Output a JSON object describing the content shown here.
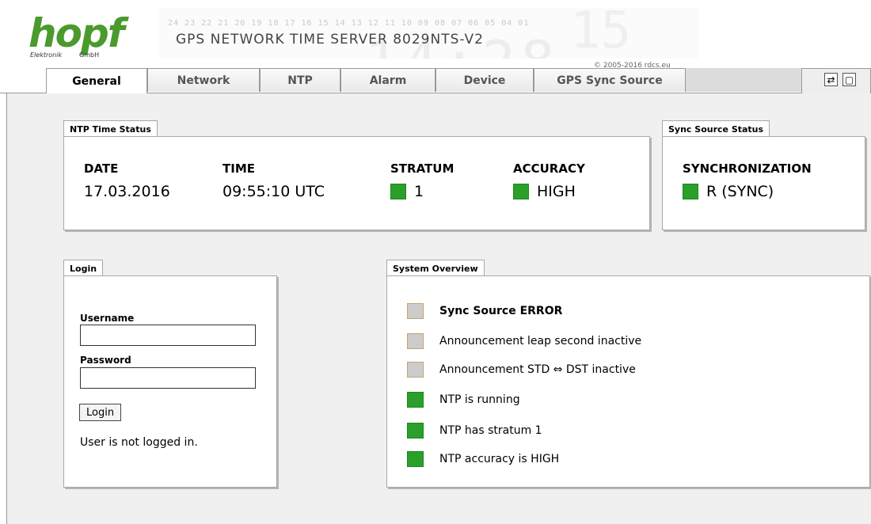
{
  "header": {
    "logo": {
      "word": "hopf",
      "sub_left": "Elektronik",
      "sub_right": "GmbH"
    },
    "banner_numbers": "24 23 22 21 20 19 18 17 16 15 14 13 12 11 10 09 08 07 06 05 04 01",
    "product_title": "GPS NETWORK TIME SERVER 8029NTS-V2",
    "copyright_prefix": "© 2005-2016 ",
    "copyright_link": "rdcs.eu"
  },
  "tabs": [
    {
      "label": "General",
      "active": true
    },
    {
      "label": "Network",
      "active": false
    },
    {
      "label": "NTP",
      "active": false
    },
    {
      "label": "Alarm",
      "active": false
    },
    {
      "label": "Device",
      "active": false
    },
    {
      "label": "GPS Sync Source",
      "active": false
    }
  ],
  "corner_buttons": {
    "refresh_glyph": "⇄",
    "window_glyph": "▢"
  },
  "ntp_status": {
    "title": "NTP Time Status",
    "date_label": "DATE",
    "date_value": "17.03.2016",
    "time_label": "TIME",
    "time_value": "09:55:10 UTC",
    "stratum_label": "STRATUM",
    "stratum_value": "1",
    "stratum_color": "#2aa02a",
    "accuracy_label": "ACCURACY",
    "accuracy_value": "HIGH",
    "accuracy_color": "#2aa02a"
  },
  "sync_status": {
    "title": "Sync Source Status",
    "sync_label": "SYNCHRONIZATION",
    "sync_value": "R (SYNC)",
    "sync_color": "#2aa02a"
  },
  "login": {
    "title": "Login",
    "username_label": "Username",
    "username_value": "",
    "password_label": "Password",
    "password_value": "",
    "button_label": "Login",
    "status_text": "User is not logged in."
  },
  "overview": {
    "title": "System Overview",
    "items": [
      {
        "text": "Sync Source ERROR",
        "state": "grey",
        "bold": true
      },
      {
        "text": "Announcement leap second inactive",
        "state": "grey",
        "bold": false
      },
      {
        "text": "Announcement STD ⇔ DST inactive",
        "state": "grey",
        "bold": false
      },
      {
        "text": "NTP is running",
        "state": "green",
        "bold": false
      },
      {
        "text": "NTP has stratum 1",
        "state": "green",
        "bold": false
      },
      {
        "text": "NTP accuracy is HIGH",
        "state": "green",
        "bold": false
      }
    ]
  },
  "colors": {
    "green": "#2aa02a",
    "grey": "#cccccc",
    "logo_green": "#4a9a2c"
  }
}
